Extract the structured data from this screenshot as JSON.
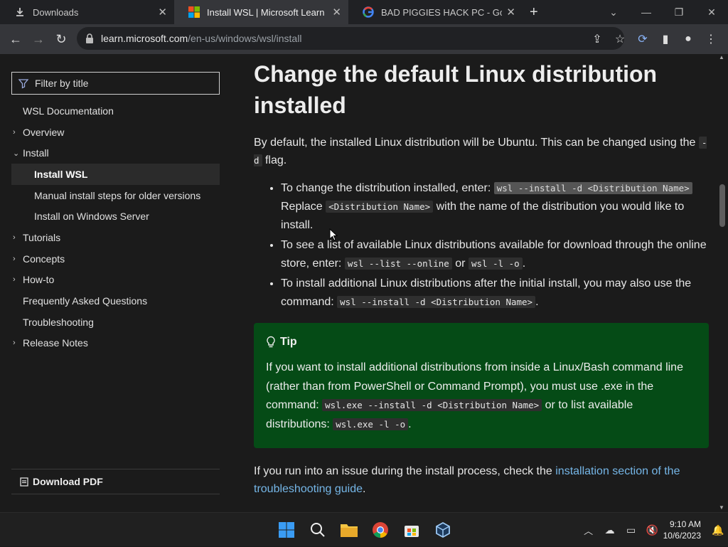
{
  "browser": {
    "tabs": [
      {
        "label": "Downloads",
        "icon": "download-icon"
      },
      {
        "label": "Install WSL | Microsoft Learn",
        "icon": "microsoft-logo-icon"
      },
      {
        "label": "BAD PIGGIES HACK PC - Google",
        "icon": "google-logo-icon"
      }
    ],
    "url_host": "learn.microsoft.com",
    "url_path": "/en-us/windows/wsl/install"
  },
  "sidebar": {
    "filter_placeholder": "Filter by title",
    "items": [
      {
        "label": "WSL Documentation",
        "level": 1,
        "chevron": ""
      },
      {
        "label": "Overview",
        "level": 1,
        "chevron": "›"
      },
      {
        "label": "Install",
        "level": 1,
        "chevron": "⌄"
      },
      {
        "label": "Install WSL",
        "level": 2,
        "chevron": "",
        "selected": true
      },
      {
        "label": "Manual install steps for older versions",
        "level": 2,
        "chevron": ""
      },
      {
        "label": "Install on Windows Server",
        "level": 2,
        "chevron": ""
      },
      {
        "label": "Tutorials",
        "level": 1,
        "chevron": "›"
      },
      {
        "label": "Concepts",
        "level": 1,
        "chevron": "›"
      },
      {
        "label": "How-to",
        "level": 1,
        "chevron": "›"
      },
      {
        "label": "Frequently Asked Questions",
        "level": 1,
        "chevron": ""
      },
      {
        "label": "Troubleshooting",
        "level": 1,
        "chevron": ""
      },
      {
        "label": "Release Notes",
        "level": 1,
        "chevron": "›"
      }
    ],
    "download_pdf": "Download PDF"
  },
  "main": {
    "heading": "Change the default Linux distribution installed",
    "intro_a": "By default, the installed Linux distribution will be Ubuntu. This can be changed using the",
    "intro_code": "-d",
    "intro_b": "flag.",
    "bullet1_a": "To change the distribution installed, enter:",
    "bullet1_code": "wsl --install -d <Distribution Name>",
    "bullet1_b": "Replace",
    "bullet1_code2": "<Distribution Name>",
    "bullet1_c": "with the name of the distribution you would like to install.",
    "bullet2_a": "To see a list of available Linux distributions available for download through the online store, enter:",
    "bullet2_code1": "wsl --list --online",
    "bullet2_or": "or",
    "bullet2_code2": "wsl -l -o",
    "bullet2_end": ".",
    "bullet3_a": "To install additional Linux distributions after the initial install, you may also use the command:",
    "bullet3_code": "wsl --install -d <Distribution Name>",
    "bullet3_end": ".",
    "tip_title": "Tip",
    "tip_a": "If you want to install additional distributions from inside a Linux/Bash command line (rather than from PowerShell or Command Prompt), you must use .exe in the command:",
    "tip_code1": "wsl.exe --install -d <Distribution Name>",
    "tip_b": "or to list available distributions:",
    "tip_code2": "wsl.exe -l -o",
    "tip_end": ".",
    "after_a": "If you run into an issue during the install process, check the",
    "after_link": "installation section of the troubleshooting guide",
    "after_end": "."
  },
  "taskbar": {
    "time": "9:10 AM",
    "date": "10/6/2023"
  },
  "colors": {
    "tip_bg": "#054b16",
    "link": "#75b6e7",
    "page_bg": "#1b1b1b"
  }
}
